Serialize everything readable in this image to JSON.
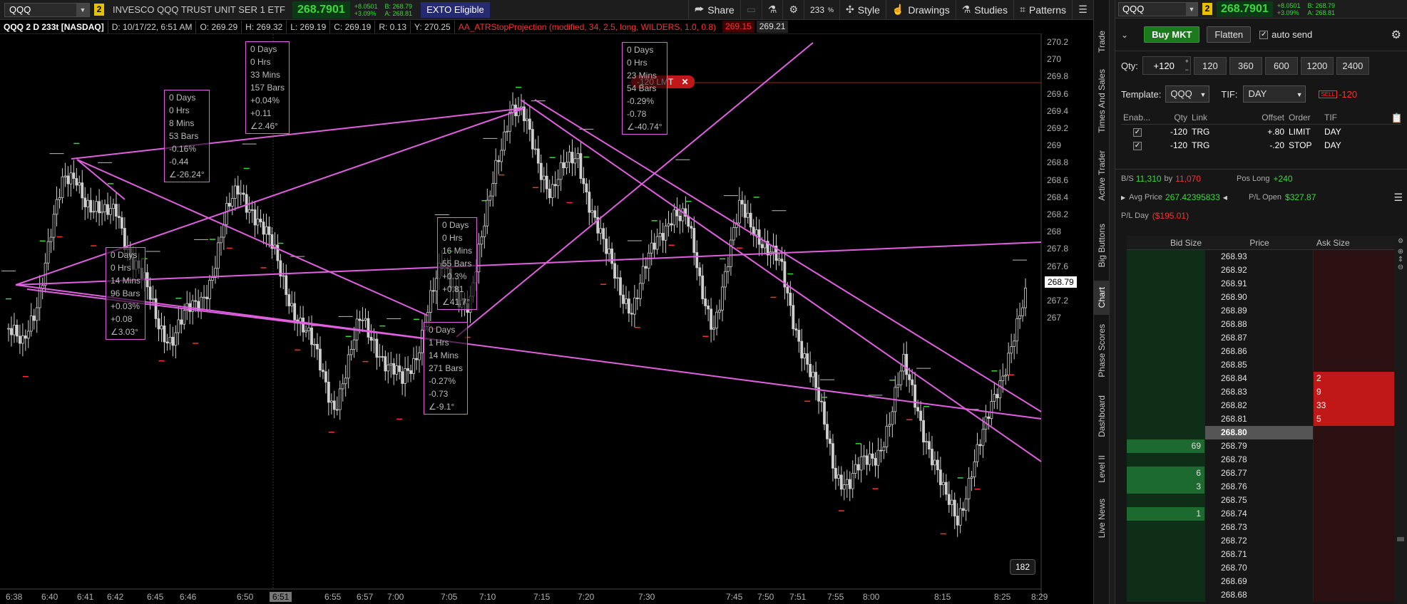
{
  "toolbar": {
    "symbol": "QQQ",
    "link_num": "2",
    "description": "INVESCO QQQ TRUST UNIT SER 1 ETF",
    "last": "268.7901",
    "change": "+8.0501",
    "change_pct": "+3.09%",
    "bid": "B: 268.79",
    "ask": "A: 268.81",
    "exto": "EXTO Eligible",
    "share": "Share",
    "zoom": "233",
    "zoom_unit": "%",
    "style": "Style",
    "drawings": "Drawings",
    "studies": "Studies",
    "patterns": "Patterns"
  },
  "chart_header": {
    "title": "QQQ 2 D 233t [NASDAQ]",
    "date": "D: 10/17/22, 6:51 AM",
    "open": "O: 269.29",
    "high": "H: 269.32",
    "low": "L: 269.19",
    "close": "C: 269.19",
    "range": "R: 0.13",
    "y": "Y: 270.25",
    "study": "AA_ATRStopProjection (modified, 34, 2.5, long, WILDERS, 1.0, 0.8)",
    "study_val1": "269.15",
    "study_val2": "269.21"
  },
  "chart": {
    "current_price": "268.79",
    "cursor_time": "6:51",
    "order_label": "-120 LMT",
    "order_close": "✕",
    "bars_count": "182"
  },
  "chart_data": {
    "type": "candlestick",
    "xlabel": "",
    "ylabel": "",
    "ylim": [
      267.0,
      270.3
    ],
    "y_ticks": [
      "270.2",
      "270",
      "269.8",
      "269.6",
      "269.4",
      "269.2",
      "269",
      "268.8",
      "268.6",
      "268.4",
      "268.2",
      "268",
      "267.8",
      "267.6",
      "267.4",
      "267.2",
      "267"
    ],
    "x_ticks": [
      "6:38",
      "6:40",
      "6:41",
      "6:42",
      "6:45",
      "6:46",
      "6:50",
      "6:55",
      "6:57",
      "7:00",
      "7:05",
      "7:10",
      "7:15",
      "7:20",
      "7:30",
      "7:45",
      "7:50",
      "7:51",
      "7:55",
      "8:00",
      "8:15",
      "8:25",
      "8:29"
    ],
    "series": [
      {
        "values": [
          268.55,
          268.4,
          268.7,
          269.1,
          269.4,
          269.5,
          269.3,
          269.2,
          269.3,
          269.0,
          268.8,
          268.6,
          268.5,
          268.6,
          268.7,
          268.9,
          269.2,
          269.4,
          269.3,
          269.1,
          268.9,
          268.7,
          268.5,
          268.3,
          268.1,
          268.3,
          268.6,
          268.5,
          268.3,
          268.2,
          268.4,
          268.7,
          268.9,
          268.8,
          268.7,
          269.1,
          269.6,
          269.9,
          269.8,
          269.6,
          269.4,
          269.5,
          269.6,
          269.3,
          269.0,
          268.8,
          268.7,
          268.9,
          269.1,
          269.3,
          269.2,
          268.8,
          268.6,
          268.9,
          269.3,
          269.2,
          269.0,
          268.9,
          268.6,
          268.3,
          268.0,
          267.7,
          267.6,
          267.7,
          267.8,
          268.0,
          268.3,
          268.1,
          267.8,
          267.5,
          267.4,
          267.7,
          267.9,
          268.2,
          268.5,
          268.7
        ]
      }
    ],
    "annotations": [
      {
        "lines": [
          "0 Days",
          "0 Hrs",
          "8 Mins",
          "53 Bars",
          "-0.16%",
          "-0.44",
          "∠-26.24°"
        ]
      },
      {
        "lines": [
          "0 Days",
          "0 Hrs",
          "33 Mins",
          "157 Bars",
          "+0.04%",
          "+0.11",
          "∠2.46°"
        ]
      },
      {
        "lines": [
          "0 Days",
          "0 Hrs",
          "14 Mins",
          "96 Bars",
          "+0.03%",
          "+0.08",
          "∠3.03°"
        ]
      },
      {
        "lines": [
          "0 Days",
          "0 Hrs",
          "16 Mins",
          "55 Bars",
          "+0.3%",
          "+0.81",
          "∠41.7°"
        ]
      },
      {
        "lines": [
          "0 Days",
          "1 Hrs",
          "14 Mins",
          "271 Bars",
          "-0.27%",
          "-0.73",
          "∠-9.1°"
        ]
      },
      {
        "lines": [
          "0 Days",
          "0 Hrs",
          "23 Mins",
          "54 Bars",
          "-0.29%",
          "-0.78",
          "∠-40.74°"
        ]
      }
    ]
  },
  "vtabs": [
    "Trade",
    "Times And Sales",
    "Active Trader",
    "Big Buttons",
    "Chart",
    "Phase Scores",
    "Dashboard",
    "Level II",
    "Live News"
  ],
  "right": {
    "symbol": "QQQ",
    "link_num": "2",
    "last": "268.7901",
    "change": "+8.0501",
    "change_pct": "+3.09%",
    "bid": "B: 268.79",
    "ask": "A: 268.81",
    "buy_mkt": "Buy MKT",
    "flatten": "Flatten",
    "auto_send": "auto send",
    "qty_label": "Qty:",
    "qty_value": "+120",
    "qty_buttons": [
      "120",
      "360",
      "600",
      "1200",
      "2400"
    ],
    "template_label": "Template:",
    "template_value": "QQQ",
    "tif_label": "TIF:",
    "tif_value": "DAY",
    "sell_tag": "SELL",
    "sell_qty": "-120",
    "order_head": [
      "Enab...",
      "Qty",
      "Link",
      "Offset",
      "Order",
      "TIF"
    ],
    "order_rows": [
      {
        "qty": "-120",
        "link": "TRG",
        "offset": "+.80",
        "order": "LIMIT",
        "tif": "DAY"
      },
      {
        "qty": "-120",
        "link": "TRG",
        "offset": "-.20",
        "order": "STOP",
        "tif": "DAY"
      }
    ],
    "bs_label": "B/S",
    "bs_buy": "11,310",
    "bs_by": "by",
    "bs_sell": "11,070",
    "pos_long_label": "Pos Long",
    "pos_long": "+240",
    "avg_price_label": "Avg Price",
    "avg_price": "267.42395833",
    "pl_open_label": "P/L Open",
    "pl_open": "$327.87",
    "pl_day_label": "P/L Day",
    "pl_day": "($195.01)",
    "ladder_head": [
      "Bid Size",
      "Price",
      "Ask Size"
    ],
    "ladder": [
      {
        "price": "268.93",
        "bid": "",
        "ask": ""
      },
      {
        "price": "268.92",
        "bid": "",
        "ask": ""
      },
      {
        "price": "268.91",
        "bid": "",
        "ask": ""
      },
      {
        "price": "268.90",
        "bid": "",
        "ask": ""
      },
      {
        "price": "268.89",
        "bid": "",
        "ask": ""
      },
      {
        "price": "268.88",
        "bid": "",
        "ask": ""
      },
      {
        "price": "268.87",
        "bid": "",
        "ask": ""
      },
      {
        "price": "268.86",
        "bid": "",
        "ask": ""
      },
      {
        "price": "268.85",
        "bid": "",
        "ask": ""
      },
      {
        "price": "268.84",
        "bid": "",
        "ask": "2"
      },
      {
        "price": "268.83",
        "bid": "",
        "ask": "9"
      },
      {
        "price": "268.82",
        "bid": "",
        "ask": "33"
      },
      {
        "price": "268.81",
        "bid": "",
        "ask": "5"
      },
      {
        "price": "268.80",
        "bid": "",
        "ask": "",
        "last": true
      },
      {
        "price": "268.79",
        "bid": "69",
        "ask": ""
      },
      {
        "price": "268.78",
        "bid": "",
        "ask": ""
      },
      {
        "price": "268.77",
        "bid": "6",
        "ask": ""
      },
      {
        "price": "268.76",
        "bid": "3",
        "ask": ""
      },
      {
        "price": "268.75",
        "bid": "",
        "ask": ""
      },
      {
        "price": "268.74",
        "bid": "1",
        "ask": ""
      },
      {
        "price": "268.73",
        "bid": "",
        "ask": ""
      },
      {
        "price": "268.72",
        "bid": "",
        "ask": ""
      },
      {
        "price": "268.71",
        "bid": "",
        "ask": ""
      },
      {
        "price": "268.70",
        "bid": "",
        "ask": ""
      },
      {
        "price": "268.69",
        "bid": "",
        "ask": ""
      },
      {
        "price": "268.68",
        "bid": "",
        "ask": ""
      }
    ]
  },
  "colors": {
    "up": "#3dd83d",
    "down": "#ff3030",
    "drawing": "#e060e0",
    "bid_bg": "#0f2e18",
    "ask_bg": "#2a1010"
  }
}
